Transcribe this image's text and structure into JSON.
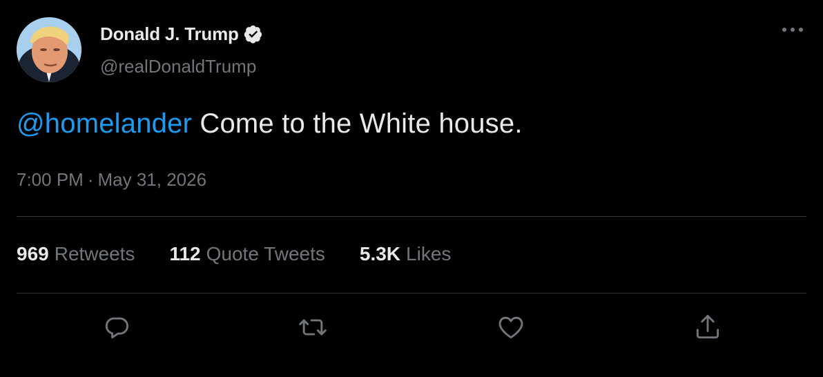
{
  "author": {
    "display_name": "Donald J. Trump",
    "handle": "@realDonaldTrump",
    "verified": true
  },
  "tweet": {
    "mention": "@homelander",
    "text": " Come to the White house.",
    "time": "7:00 PM",
    "separator": "·",
    "date": "May 31, 2026"
  },
  "stats": {
    "retweets_count": "969",
    "retweets_label": "Retweets",
    "quotes_count": "112",
    "quotes_label": "Quote Tweets",
    "likes_count": "5.3K",
    "likes_label": "Likes"
  },
  "icons": {
    "more": "more-dots-icon",
    "reply": "reply-icon",
    "retweet": "retweet-icon",
    "like": "heart-icon",
    "share": "share-icon",
    "verified": "verified-badge-icon"
  },
  "colors": {
    "background": "#000000",
    "text": "#e7e9ea",
    "secondary": "#71767b",
    "accent": "#1d9bf0",
    "divider": "#2f3336"
  }
}
